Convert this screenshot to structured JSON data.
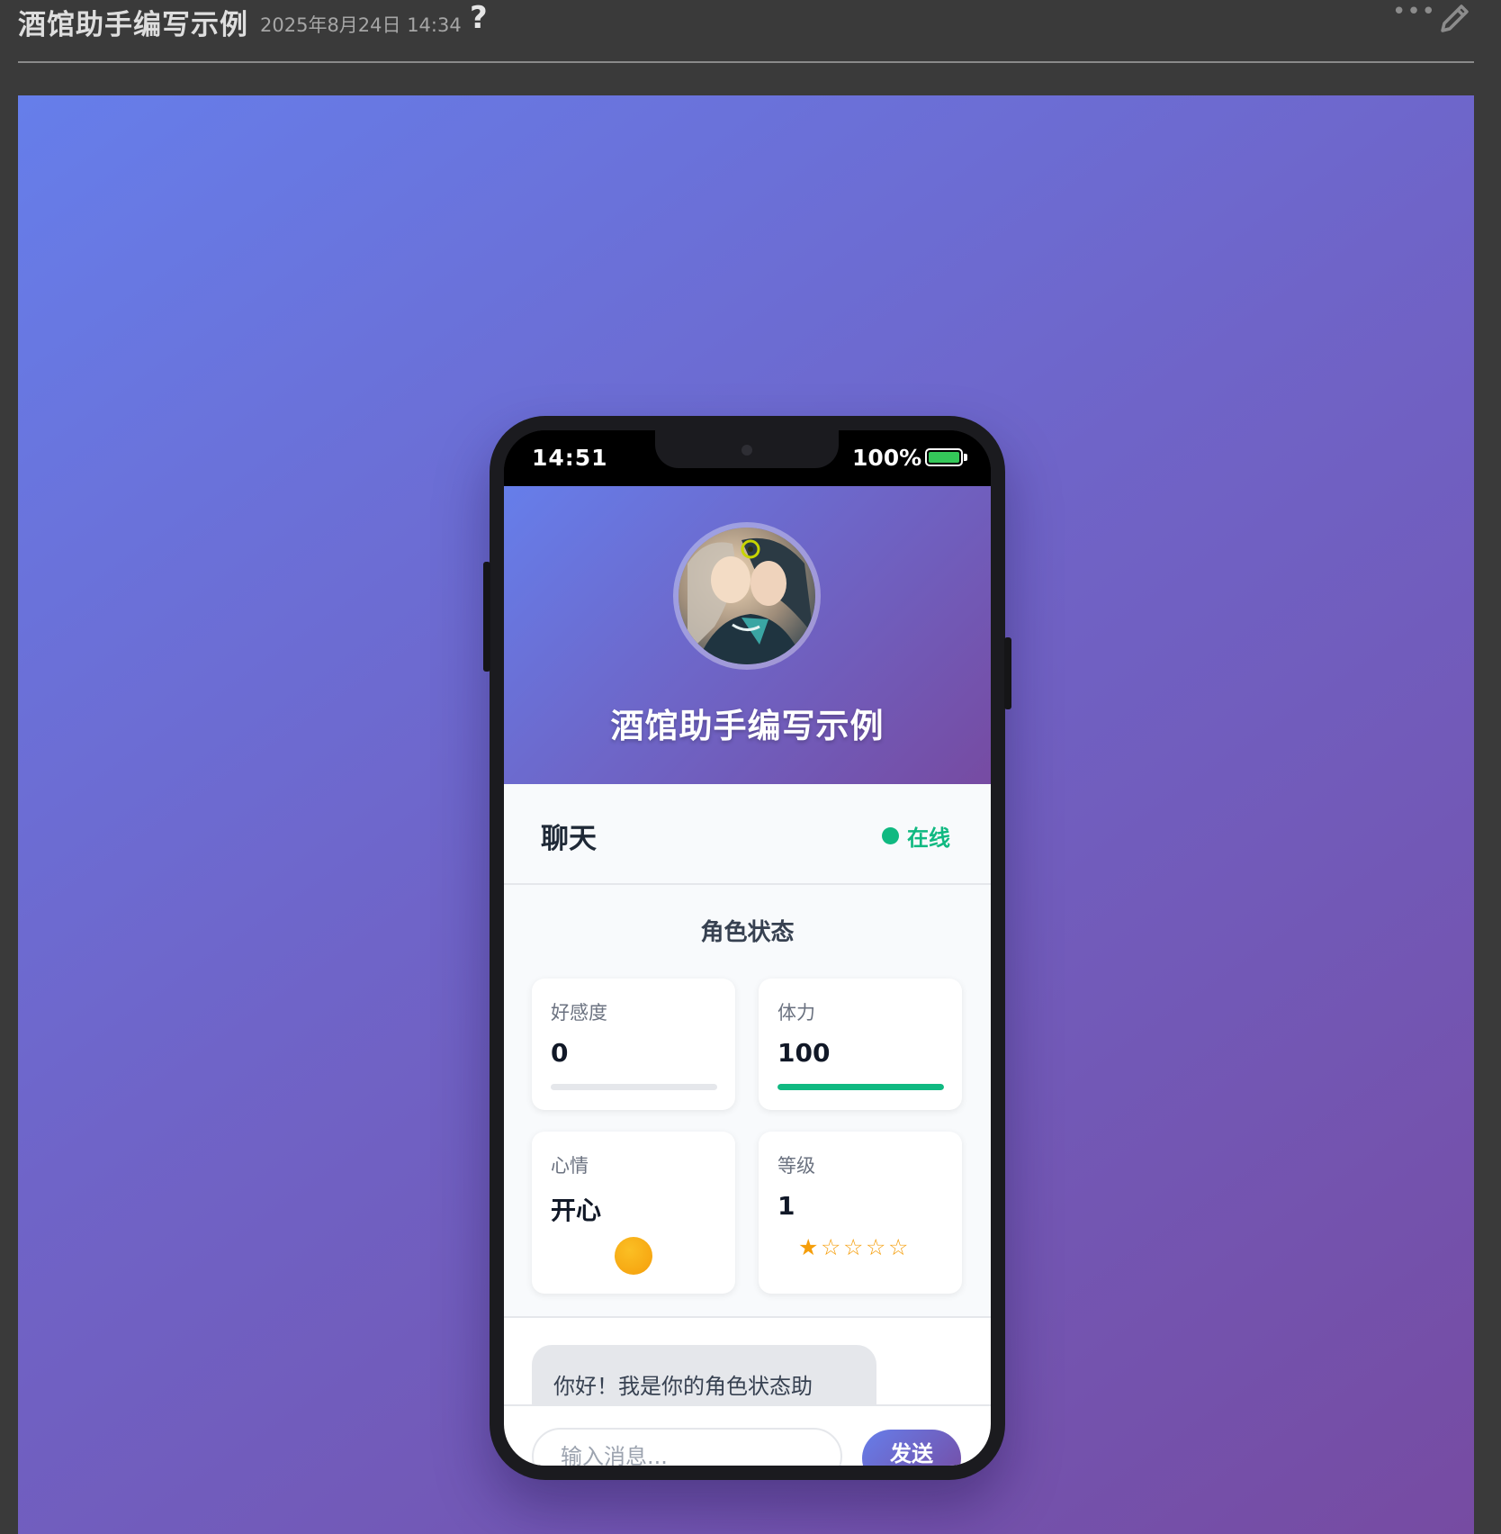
{
  "post": {
    "title": "酒馆助手编写示例",
    "date": "2025年8月24日 14:34",
    "help_glyph": "?",
    "more_glyph": "•••",
    "help_icon": "question-mark-icon",
    "more_icon": "more-horizontal-icon",
    "edit_icon": "pencil-icon"
  },
  "phone": {
    "status_bar": {
      "time": "14:51",
      "battery": "100%",
      "battery_level": 1.0
    },
    "profile": {
      "name": "酒馆助手编写示例",
      "avatar_icon": "character-avatar"
    },
    "chat_header": {
      "title": "聊天",
      "status": "在线",
      "status_color": "#10b981"
    },
    "status_panel": {
      "title": "角色状态",
      "affection": {
        "label": "好感度",
        "value": "0",
        "level": 0.0
      },
      "stamina": {
        "label": "体力",
        "value": "100",
        "level": 1.0
      },
      "mood": {
        "label": "心情",
        "value": "开心",
        "icon": "sun-icon"
      },
      "rank": {
        "label": "等级",
        "value": "1",
        "stars_filled": 1,
        "stars_total": 5
      }
    },
    "messages": [
      {
        "text": "你好！我是你的角色状态助"
      }
    ],
    "composer": {
      "placeholder": "输入消息...",
      "send_label": "发送"
    }
  },
  "colors": {
    "gradient_start": "#667eea",
    "gradient_end": "#764ba2",
    "online_green": "#10b981",
    "star_gold": "#f59e0b"
  }
}
